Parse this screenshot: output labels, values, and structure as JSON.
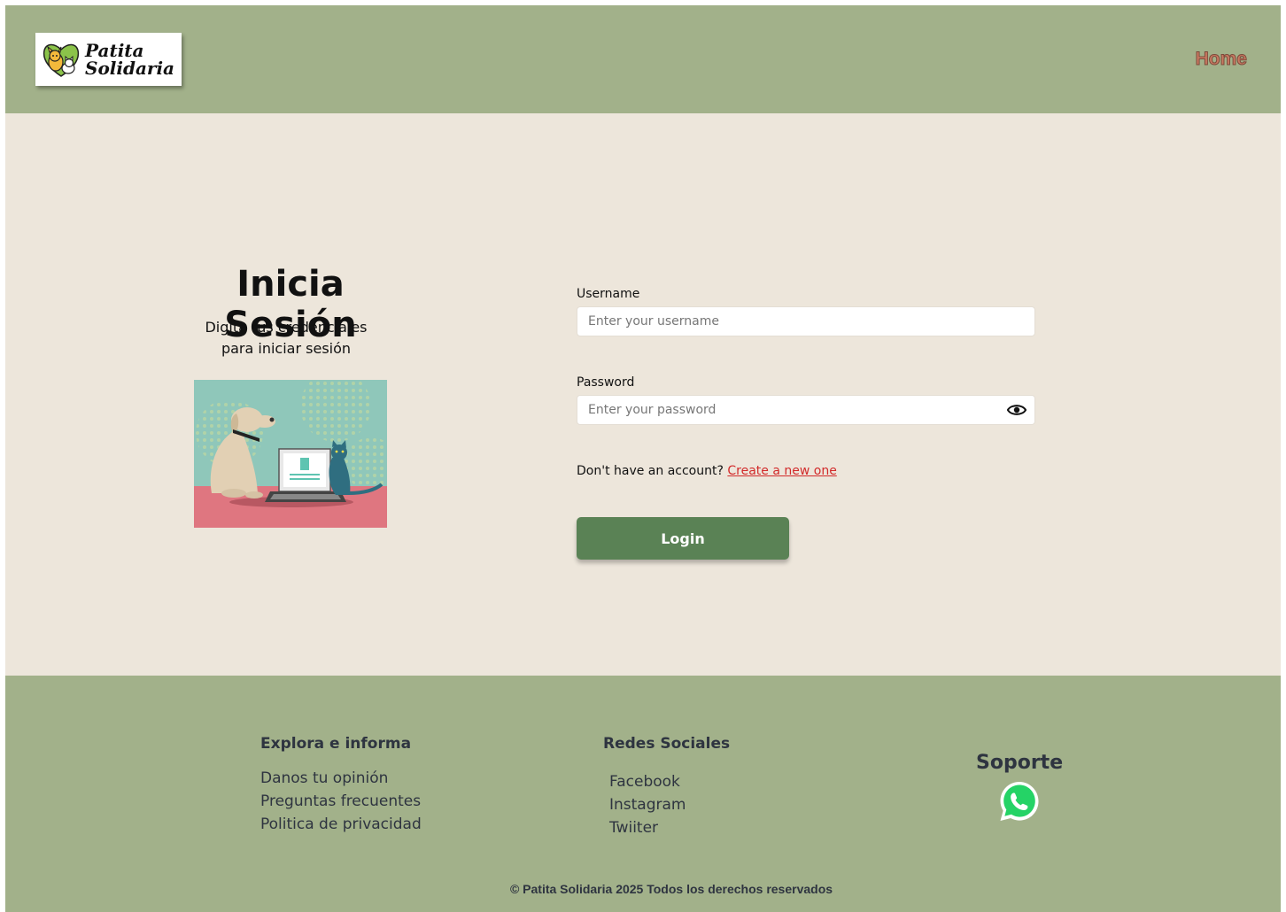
{
  "header": {
    "logo_line1": "Patita",
    "logo_line2": "Solidaria",
    "nav_home": "Home"
  },
  "login": {
    "title": "Inicia Sesión",
    "subtitle": "Digita tus credenciales para iniciar sesión",
    "username_label": "Username",
    "username_placeholder": "Enter your username",
    "password_label": "Password",
    "password_placeholder": "Enter your password",
    "signup_prompt": "Don't have an account?",
    "signup_link": "Create a new one",
    "login_button": "Login"
  },
  "footer": {
    "col1_title": "Explora e informa",
    "col1_links": [
      "Danos tu opinión",
      "Preguntas frecuentes",
      "Politica de privacidad"
    ],
    "col2_title": "Redes Sociales",
    "col2_links": [
      "Facebook",
      "Instagram",
      "Twiiter"
    ],
    "support_title": "Soporte",
    "copyright": "© Patita Solidaria 2025 Todos los derechos reservados"
  },
  "colors": {
    "header_bg": "#a2b18a",
    "page_bg": "#ede6db",
    "primary_button": "#5a8255",
    "link_red": "#d22b2b",
    "nav_home": "#c97a62"
  },
  "icons": [
    "logo-dog-cat-icon",
    "eye-icon",
    "whatsapp-icon"
  ]
}
